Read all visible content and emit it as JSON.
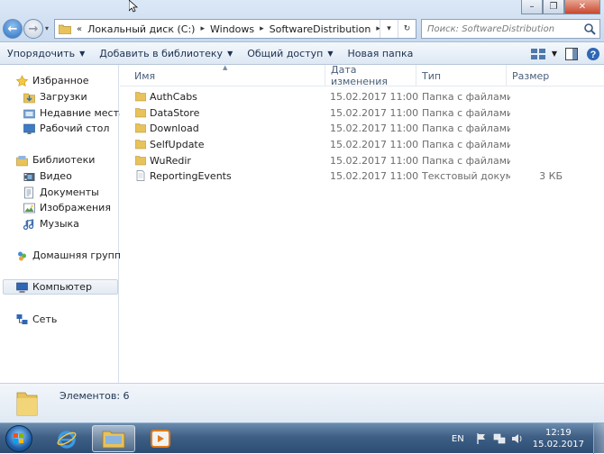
{
  "window": {
    "minimize": "–",
    "maximize": "❐",
    "close": "✕"
  },
  "address": {
    "chevron": "«",
    "crumbs": [
      "Локальный диск (C:)",
      "Windows",
      "SoftwareDistribution"
    ],
    "dropdown": "▾",
    "refresh": "↻"
  },
  "search": {
    "placeholder": "Поиск: SoftwareDistribution"
  },
  "toolbar": {
    "organize": "Упорядочить",
    "add_to_library": "Добавить в библиотеку",
    "share": "Общий доступ",
    "new_folder": "Новая папка"
  },
  "nav": {
    "favorites": "Избранное",
    "downloads": "Загрузки",
    "recent": "Недавние места",
    "desktop": "Рабочий стол",
    "libraries": "Библиотеки",
    "video": "Видео",
    "documents": "Документы",
    "images": "Изображения",
    "music": "Музыка",
    "homegroup": "Домашняя группа",
    "computer": "Компьютер",
    "network": "Сеть"
  },
  "columns": {
    "name": "Имя",
    "date": "Дата изменения",
    "type": "Тип",
    "size": "Размер"
  },
  "files": [
    {
      "name": "AuthCabs",
      "date": "15.02.2017 11:00",
      "type": "Папка с файлами",
      "size": "",
      "icon": "folder-icon"
    },
    {
      "name": "DataStore",
      "date": "15.02.2017 11:00",
      "type": "Папка с файлами",
      "size": "",
      "icon": "folder-icon"
    },
    {
      "name": "Download",
      "date": "15.02.2017 11:00",
      "type": "Папка с файлами",
      "size": "",
      "icon": "folder-icon"
    },
    {
      "name": "SelfUpdate",
      "date": "15.02.2017 11:00",
      "type": "Папка с файлами",
      "size": "",
      "icon": "folder-icon"
    },
    {
      "name": "WuRedir",
      "date": "15.02.2017 11:00",
      "type": "Папка с файлами",
      "size": "",
      "icon": "folder-icon"
    },
    {
      "name": "ReportingEvents",
      "date": "15.02.2017 11:00",
      "type": "Текстовый докум...",
      "size": "3 КБ",
      "icon": "text-file-icon"
    }
  ],
  "details": {
    "count_text": "Элементов: 6"
  },
  "taskbar": {
    "lang": "EN",
    "time": "12:19",
    "date": "15.02.2017"
  },
  "colors": {
    "accent": "#2a6fc0",
    "folder": "#e8c25a",
    "taskbar": "#3f5f85"
  }
}
